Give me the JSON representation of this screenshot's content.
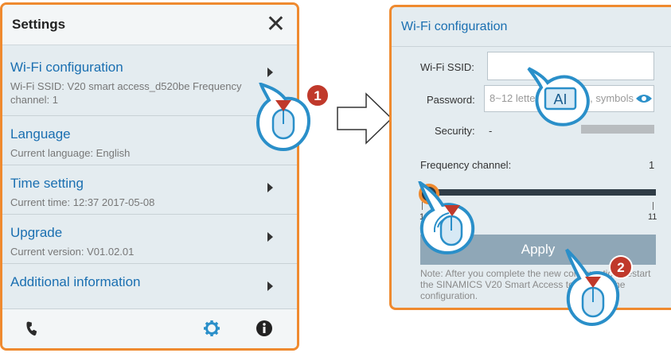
{
  "settings": {
    "title": "Settings",
    "close_glyph": "✕",
    "items": [
      {
        "title": "Wi-Fi configuration",
        "sub": "Wi-Fi SSID: V20 smart access_d520be   Frequency channel: 1"
      },
      {
        "title": "Language",
        "sub": "Current language: English"
      },
      {
        "title": "Time setting",
        "sub": "Current time: 12:37 2017-05-08"
      },
      {
        "title": "Upgrade",
        "sub": "Current version: V01.02.01"
      },
      {
        "title": "Additional information",
        "sub": ""
      }
    ],
    "footer_icons": [
      "phone-icon",
      "gear-icon",
      "info-icon"
    ]
  },
  "wifi": {
    "title": "Wi-Fi configuration",
    "ssid_label": "Wi-Fi SSID:",
    "ssid_value": "",
    "password_label": "Password:",
    "password_placeholder": "8~12 letters, numbers, symbols",
    "security_label": "Security:",
    "security_value": "-",
    "freq_label": "Frequency channel:",
    "freq_value": "1",
    "slider_min": "1",
    "slider_max": "11",
    "slider_level": 0,
    "apply_label": "Apply",
    "note": "Note: After you complete the new configuration, restart the SINAMICS V20 Smart Access to activate the configuration."
  },
  "callouts": {
    "step1": "1",
    "step2": "2",
    "text_cursor_label": "AI"
  },
  "colors": {
    "accent_orange": "#ef8a2f",
    "link_blue": "#1a6fb1",
    "callout_blue": "#2a8fc9",
    "badge_red": "#c0392b"
  }
}
